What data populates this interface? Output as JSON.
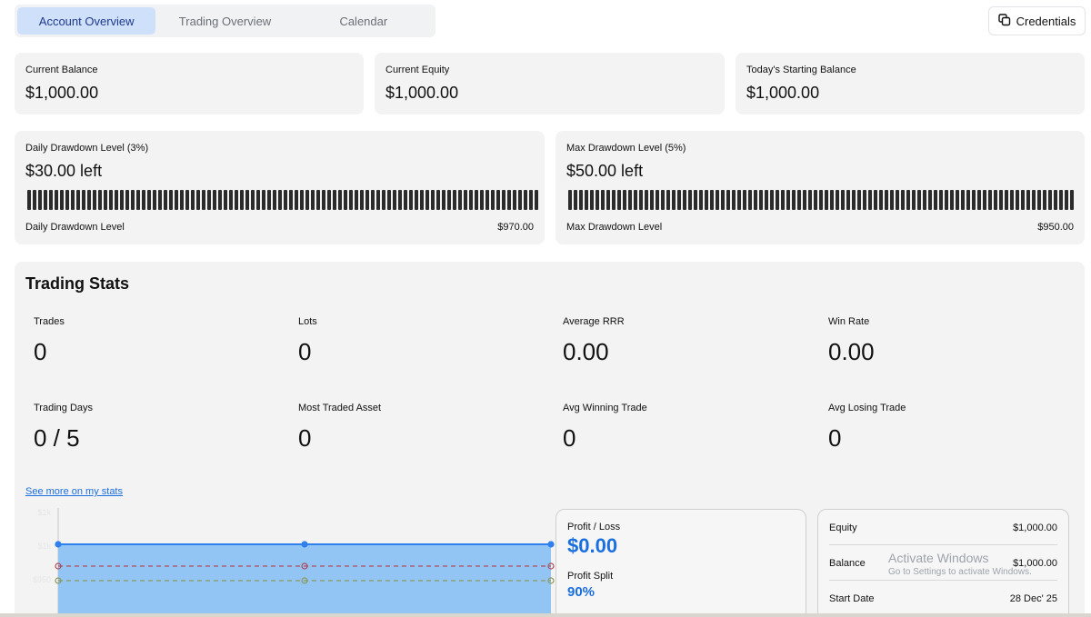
{
  "tabs": [
    {
      "label": "Account Overview",
      "active": true
    },
    {
      "label": "Trading Overview",
      "active": false
    },
    {
      "label": "Calendar",
      "active": false
    }
  ],
  "credentials_label": "Credentials",
  "summary": [
    {
      "label": "Current Balance",
      "value": "$1,000.00"
    },
    {
      "label": "Current Equity",
      "value": "$1,000.00"
    },
    {
      "label": "Today's Starting Balance",
      "value": "$1,000.00"
    }
  ],
  "drawdown": [
    {
      "title": "Daily Drawdown Level (3%)",
      "left": "$30.00 left",
      "foot_label": "Daily Drawdown Level",
      "foot_value": "$970.00",
      "remaining": 1.0
    },
    {
      "title": "Max Drawdown Level (5%)",
      "left": "$50.00 left",
      "foot_label": "Max Drawdown Level",
      "foot_value": "$950.00",
      "remaining": 1.0
    }
  ],
  "stats": {
    "title": "Trading Stats",
    "items": [
      {
        "label": "Trades",
        "value": "0"
      },
      {
        "label": "Lots",
        "value": "0"
      },
      {
        "label": "Average RRR",
        "value": "0.00"
      },
      {
        "label": "Win Rate",
        "value": "0.00"
      },
      {
        "label": "Trading Days",
        "value": "0 / 5"
      },
      {
        "label": "Most Traded Asset",
        "value": "0"
      },
      {
        "label": "Avg Winning Trade",
        "value": "0"
      },
      {
        "label": "Avg Losing Trade",
        "value": "0"
      }
    ],
    "see_more": "See more on my stats"
  },
  "chart_data": {
    "type": "area",
    "x": [
      0,
      1,
      2
    ],
    "series": [
      {
        "values": [
          1000,
          1000,
          1000
        ],
        "color": "#2f80ed"
      },
      {
        "values": [
          970,
          970,
          970
        ],
        "color": "#b04a5a"
      },
      {
        "values": [
          950,
          950,
          950
        ],
        "color": "#8a9a5b"
      }
    ],
    "y_ticks": [
      "$1k",
      "$1k",
      "$950"
    ],
    "ylim": [
      900,
      1050
    ],
    "fill_color": "#93c5f4"
  },
  "profit_card": {
    "pl_label": "Profit / Loss",
    "pl_value": "$0.00",
    "split_label": "Profit Split",
    "split_value": "90%",
    "accent": "#1a6fe0"
  },
  "equity_card": {
    "rows": [
      {
        "label": "Equity",
        "value": "$1,000.00"
      },
      {
        "label": "Balance",
        "value": "$1,000.00"
      },
      {
        "label": "Start Date",
        "value": "28 Dec' 25"
      }
    ]
  },
  "watermark": {
    "line1": "Activate Windows",
    "line2": "Go to Settings to activate Windows."
  }
}
